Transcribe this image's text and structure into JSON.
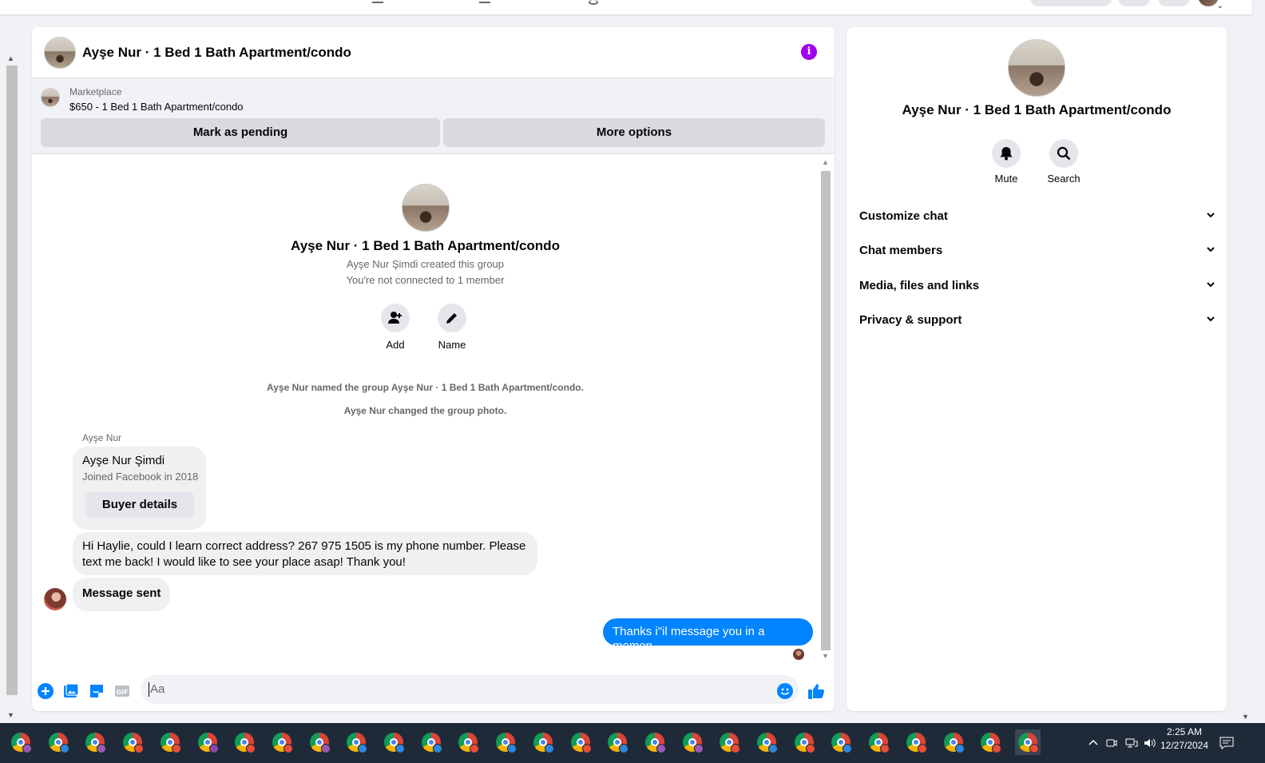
{
  "chat": {
    "title": "Ayşe Nur · 1 Bed 1 Bath Apartment/condo",
    "listing": {
      "label": "Marketplace",
      "price_title": "$650 - 1 Bed 1 Bath Apartment/condo",
      "pending_btn": "Mark as pending",
      "more_btn": "More options"
    },
    "intro": {
      "name": "Ayşe Nur · 1 Bed 1 Bath Apartment/condo",
      "created": "Ayşe Nur Şimdi created this group",
      "connected": "You're not connected to 1 member",
      "add_label": "Add",
      "name_label": "Name"
    },
    "system": [
      "Ayşe Nur named the group Ayşe Nur · 1 Bed 1 Bath Apartment/condo.",
      "Ayşe Nur changed the group photo."
    ],
    "sender_name": "Ayşe Nur",
    "buyer_card": {
      "name": "Ayşe Nur Şimdi",
      "joined": "Joined Facebook in 2018",
      "button": "Buyer details"
    },
    "messages": {
      "incoming_1_line1": "Hi Haylie, could I learn correct address? 267 975 1505 is my phone number. Please",
      "incoming_1_line2": "text me back! I would like to see your place asap! Thank you!",
      "incoming_2": "Message sent",
      "outgoing_1": "Thanks i\"il message you in a momen"
    },
    "composer_placeholder": "Aa",
    "composer_icons": [
      "plus-circle-icon",
      "image-icon",
      "sticker-icon",
      "gif-icon",
      "emoji-icon",
      "thumbs-up-icon"
    ]
  },
  "info_panel": {
    "name": "Ayşe Nur · 1 Bed 1 Bath Apartment/condo",
    "mute_label": "Mute",
    "search_label": "Search",
    "sections": [
      "Customize chat",
      "Chat members",
      "Media, files and links",
      "Privacy & support"
    ]
  },
  "taskbar": {
    "time": "2:25 AM",
    "date": "12/27/2024",
    "app_count": 28,
    "profile_colors": [
      "#9b59b6",
      "#2e86de",
      "#9b59b6",
      "#e74c3c",
      "#e74c3c",
      "#8e44ad",
      "#e74c3c",
      "#e74c3c",
      "#9b59b6",
      "#2e86de",
      "#2e86de",
      "#2e86de",
      "#e74c3c",
      "#2e86de",
      "#2e86de",
      "#e74c3c",
      "#2e86de",
      "#9b59b6",
      "#9b59b6",
      "#e74c3c",
      "#2e86de",
      "#e74c3c",
      "#2e86de",
      "#e74c3c",
      "#e74c3c",
      "#2e86de",
      "#e74c3c",
      "#e74c3c",
      "#e74c3c"
    ]
  },
  "colors": {
    "messenger_blue": "#0084ff",
    "info_purple": "#a100f2",
    "taskbar_bg": "#1f2a38"
  }
}
